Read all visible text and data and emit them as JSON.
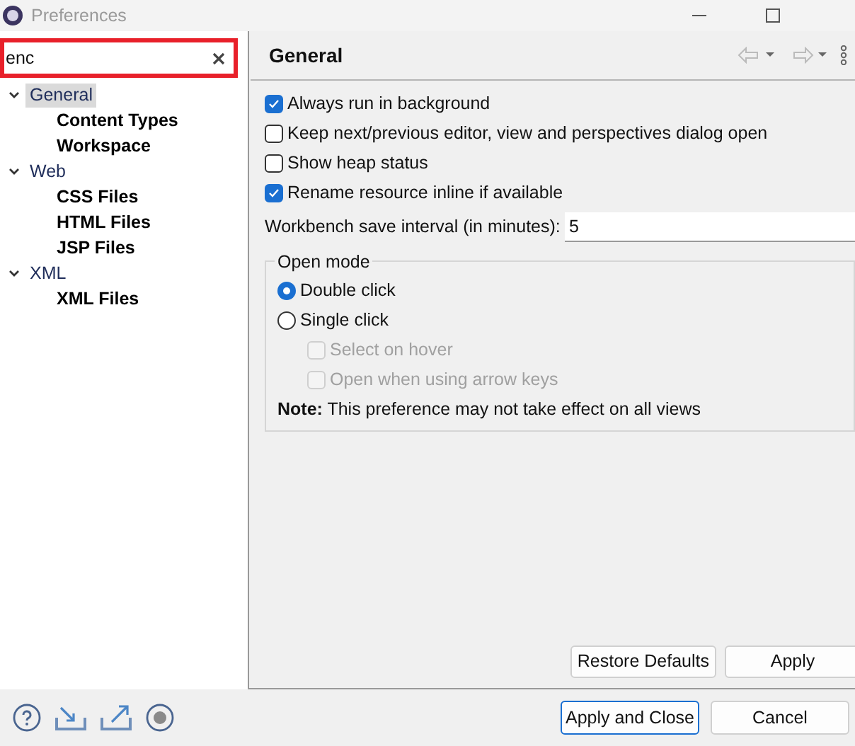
{
  "window": {
    "title": "Preferences"
  },
  "filter": {
    "value": "enc"
  },
  "tree": [
    {
      "label": "General",
      "selected": true,
      "expanded": true,
      "matched": false,
      "children": [
        {
          "label": "Content Types",
          "selected": false,
          "matched": true
        },
        {
          "label": "Workspace",
          "selected": false,
          "matched": true
        }
      ]
    },
    {
      "label": "Web",
      "selected": false,
      "expanded": true,
      "matched": false,
      "children": [
        {
          "label": "CSS Files",
          "selected": false,
          "matched": true
        },
        {
          "label": "HTML Files",
          "selected": false,
          "matched": true
        },
        {
          "label": "JSP Files",
          "selected": false,
          "matched": true
        }
      ]
    },
    {
      "label": "XML",
      "selected": false,
      "expanded": true,
      "matched": false,
      "children": [
        {
          "label": "XML Files",
          "selected": false,
          "matched": true
        }
      ]
    }
  ],
  "page": {
    "title": "General",
    "options": [
      {
        "label": "Always run in background",
        "checked": true
      },
      {
        "label": "Keep next/previous editor, view and perspectives dialog open",
        "checked": false
      },
      {
        "label": "Show heap status",
        "checked": false
      },
      {
        "label": "Rename resource inline if available",
        "checked": true
      }
    ],
    "save_interval": {
      "label": "Workbench save interval (in minutes):",
      "value": "5"
    },
    "open_mode": {
      "title": "Open mode",
      "modes": [
        {
          "label": "Double click",
          "selected": true
        },
        {
          "label": "Single click",
          "selected": false
        }
      ],
      "sub_options": [
        {
          "label": "Select on hover",
          "checked": false,
          "disabled": true
        },
        {
          "label": "Open when using arrow keys",
          "checked": false,
          "disabled": true
        }
      ],
      "note": "**Note:** This preference may not take effect on all views"
    },
    "buttons": [
      "Restore Defaults",
      "Apply"
    ]
  },
  "footer_buttons": [
    {
      "label": "Apply and Close",
      "default": true
    },
    {
      "label": "Cancel",
      "default": false
    }
  ]
}
